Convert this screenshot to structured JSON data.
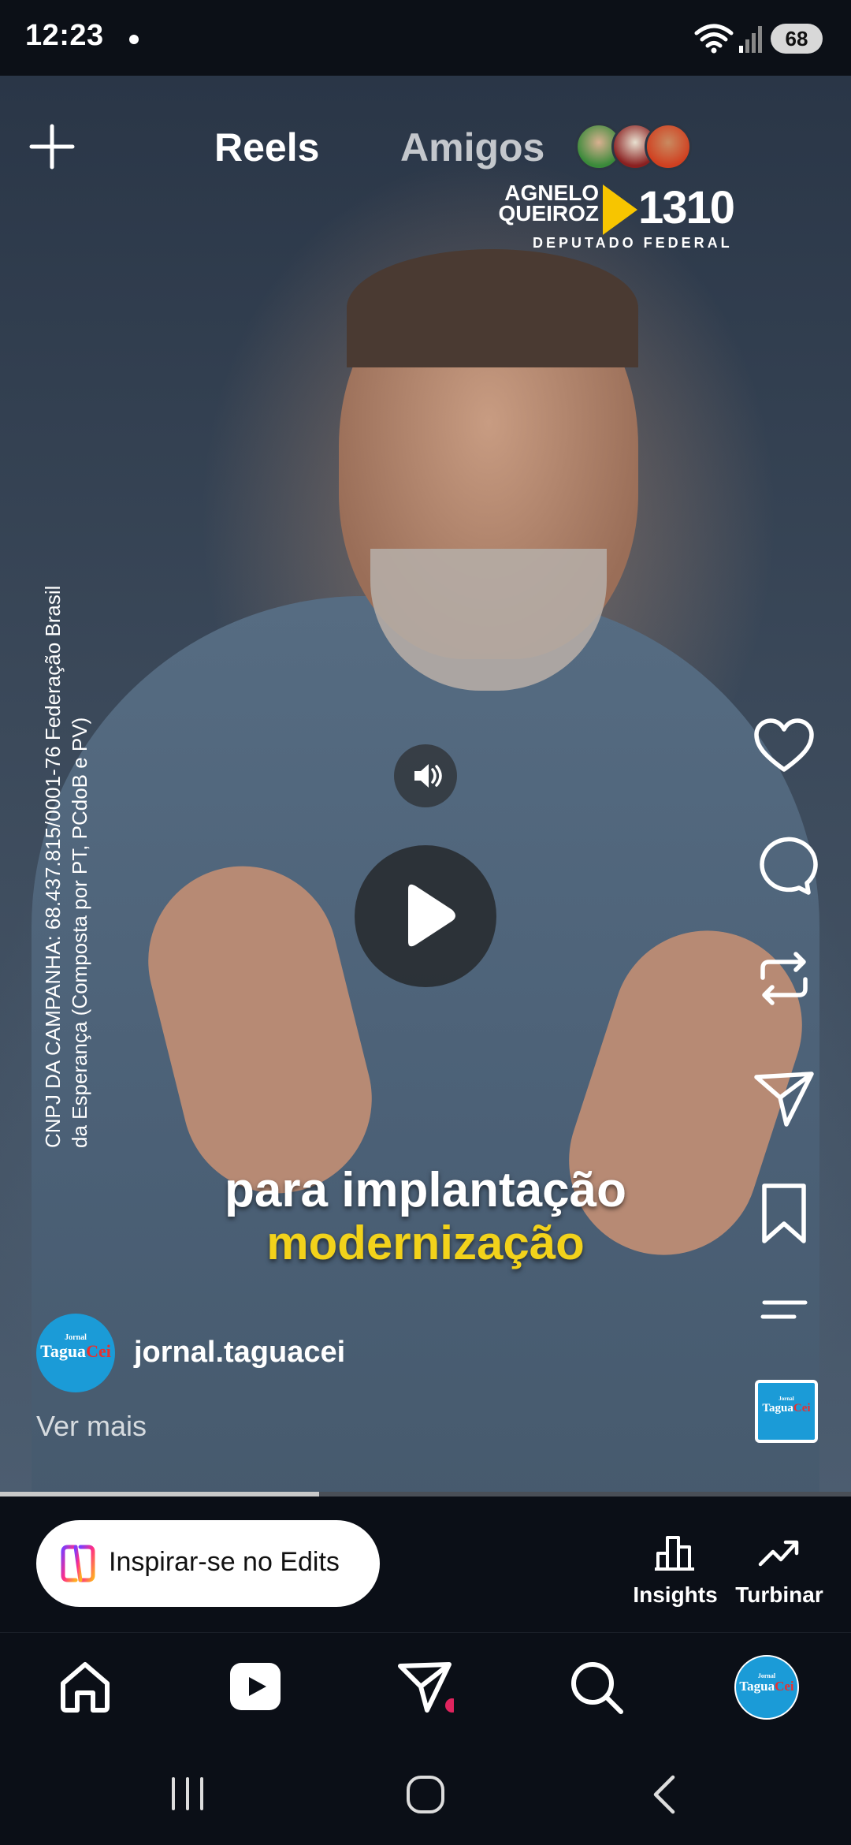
{
  "status_bar": {
    "time": "12:23",
    "battery_level": "68",
    "icons": [
      "notification-dot-icon",
      "wifi-icon",
      "signal-icon",
      "battery-icon"
    ]
  },
  "top_nav": {
    "tabs": [
      {
        "label": "Reels",
        "active": true
      },
      {
        "label": "Amigos",
        "active": false
      }
    ],
    "create_icon": "plus-icon"
  },
  "video": {
    "logo": {
      "name_line1": "AGNELO",
      "name_line2": "QUEIROZ",
      "number": "1310",
      "subtitle": "DEPUTADO FEDERAL"
    },
    "vertical_text_line1": "CNPJ DA CAMPANHA: 68.437.815/0001-76 Federação Brasil",
    "vertical_text_line2": "da Esperança (Composta por PT, PCdoB e PV)",
    "caption_line1": "para implantação",
    "caption_line2": "modernização",
    "progress": 0.375
  },
  "actions": [
    "heart-icon",
    "comment-icon",
    "repost-icon",
    "share-icon",
    "bookmark-icon",
    "more-icon"
  ],
  "author": {
    "username": "jornal.taguacei",
    "logo_small": "Jornal",
    "logo_main": "Tagua",
    "logo_accent": "Cei",
    "see_more": "Ver mais"
  },
  "edits_bar": {
    "button_label": "Inspirar-se no Edits",
    "insights_label": "Insights",
    "boost_label": "Turbinar"
  },
  "bottom_nav": [
    "home-icon",
    "reels-icon",
    "messages-icon",
    "search-icon",
    "profile-avatar"
  ],
  "system_nav": [
    "recents-icon",
    "home-button-icon",
    "back-icon"
  ],
  "colors": {
    "caption_highlight": "#f2d21b",
    "logo_triangle": "#f7c500",
    "avatar_blue": "#1b9bd7",
    "notification": "#e0245e"
  }
}
